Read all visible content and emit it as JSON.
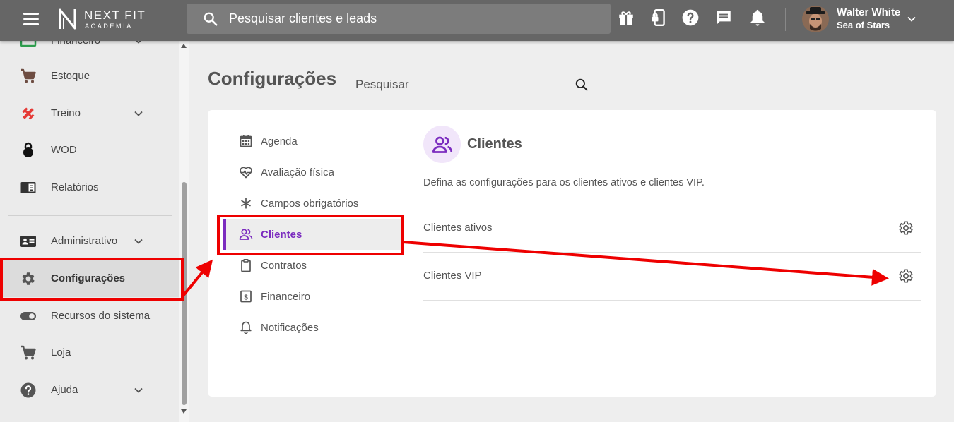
{
  "header": {
    "logo_title": "NEXT FIT",
    "logo_subtitle": "ACADEMIA",
    "search_placeholder": "Pesquisar clientes e leads",
    "icons": [
      "gift-icon",
      "mobile-lock-icon",
      "help-icon",
      "chat-icon",
      "bell-icon"
    ],
    "user_name": "Walter White",
    "user_org": "Sea of Stars"
  },
  "sidebar": {
    "partial_label": "Financeiro",
    "items": [
      {
        "label": "Estoque",
        "icon": "cart-icon"
      },
      {
        "label": "Treino",
        "icon": "dumbbell-icon",
        "expandable": true
      },
      {
        "label": "WOD",
        "icon": "kettlebell-icon"
      },
      {
        "label": "Relatórios",
        "icon": "report-icon"
      },
      {
        "label": "Administrativo",
        "icon": "id-card-icon",
        "expandable": true
      },
      {
        "label": "Configurações",
        "icon": "gear-icon",
        "active": true
      },
      {
        "label": "Recursos do sistema",
        "icon": "toggle-icon"
      },
      {
        "label": "Loja",
        "icon": "cart-icon"
      },
      {
        "label": "Ajuda",
        "icon": "help-icon",
        "expandable": true
      }
    ]
  },
  "main": {
    "title": "Configurações",
    "search_placeholder": "Pesquisar",
    "menu": [
      {
        "label": "Agenda",
        "icon": "calendar-icon"
      },
      {
        "label": "Avaliação física",
        "icon": "heart-pulse-icon"
      },
      {
        "label": "Campos obrigatórios",
        "icon": "asterisk-icon"
      },
      {
        "label": "Clientes",
        "icon": "users-icon",
        "active": true
      },
      {
        "label": "Contratos",
        "icon": "clipboard-icon"
      },
      {
        "label": "Financeiro",
        "icon": "dollar-icon"
      },
      {
        "label": "Notificações",
        "icon": "bell-icon"
      }
    ],
    "section": {
      "title": "Clientes",
      "description": "Defina as configurações para os clientes ativos e clientes VIP.",
      "options": [
        {
          "label": "Clientes ativos"
        },
        {
          "label": "Clientes VIP"
        }
      ]
    }
  },
  "colors": {
    "topbar": "#666666",
    "accent": "#7b2cbf",
    "annotation": "#ee0000"
  }
}
